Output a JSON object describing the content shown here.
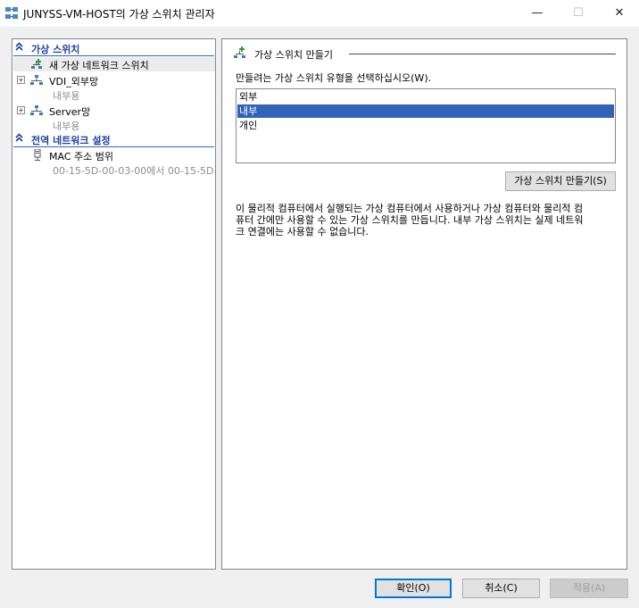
{
  "window": {
    "title": "JUNYSS-VM-HOST의 가상 스위치 관리자",
    "minimize_glyph": "—",
    "maximize_glyph": "☐",
    "close_glyph": "✕"
  },
  "left_pane": {
    "section_virtual_switches": "가상 스위치",
    "new_switch_item": "새 가상 네트워크 스위치",
    "switches": [
      {
        "label": "VDI_외부망",
        "subtitle": "내부용"
      },
      {
        "label": "Server망",
        "subtitle": "내부용"
      }
    ],
    "section_global": "전역 네트워크 설정",
    "mac_range": {
      "label": "MAC 주소 범위",
      "subtitle": "00-15-5D-00-03-00에서 00-15-5D-..."
    }
  },
  "right_pane": {
    "group_title": "가상 스위치 만들기",
    "prompt": "만들려는 가상 스위치 유형을 선택하십시오(W).",
    "switch_types": [
      "외부",
      "내부",
      "개인"
    ],
    "selected_type": "내부",
    "create_button": "가상 스위치 만들기(S)",
    "description": "이 물리적 컴퓨터에서 실행되는 가상 컴퓨터에서 사용하거나 가상 컴퓨터와 물리적 컴\n퓨터 간에만 사용할 수 있는 가상 스위치를 만듭니다. 내부 가상 스위치는 실제 네트워\n크 연결에는 사용할 수 없습니다."
  },
  "footer": {
    "ok_button": "확인(O)",
    "cancel_button": "취소(C)",
    "apply_button": "적용(A)"
  },
  "colors": {
    "selection_blue": "#3163b8",
    "section_header": "#1f3f9f",
    "window_bg": "#f0f0f0"
  },
  "icons": [
    "vswitch-manager-icon",
    "add-switch-icon",
    "network-switch-icon",
    "mac-address-icon",
    "collapse-chevron-icon"
  ]
}
